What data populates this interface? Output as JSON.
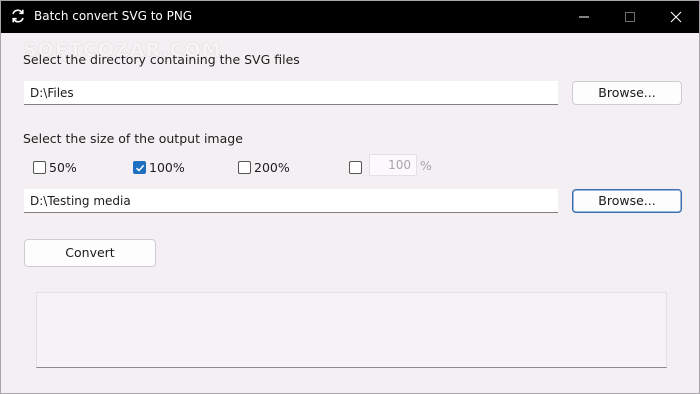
{
  "window": {
    "title": "Batch convert SVG to PNG"
  },
  "watermark": "SOFTCOZAR.COM",
  "source": {
    "label": "Select the directory containing the SVG files",
    "path_value": "D:\\Files",
    "browse_label": "Browse..."
  },
  "size": {
    "label": "Select the size of the output image",
    "options": [
      {
        "label": "50%",
        "checked": false
      },
      {
        "label": "100%",
        "checked": true
      },
      {
        "label": "200%",
        "checked": false
      }
    ],
    "custom": {
      "checked": false,
      "value": "100",
      "unit": "%"
    }
  },
  "output": {
    "path_value": "D:\\Testing media",
    "browse_label": "Browse..."
  },
  "actions": {
    "convert_label": "Convert"
  },
  "colors": {
    "titlebar": "#000000",
    "window_bg": "#f4eff3",
    "accent": "#1f6fc1"
  }
}
